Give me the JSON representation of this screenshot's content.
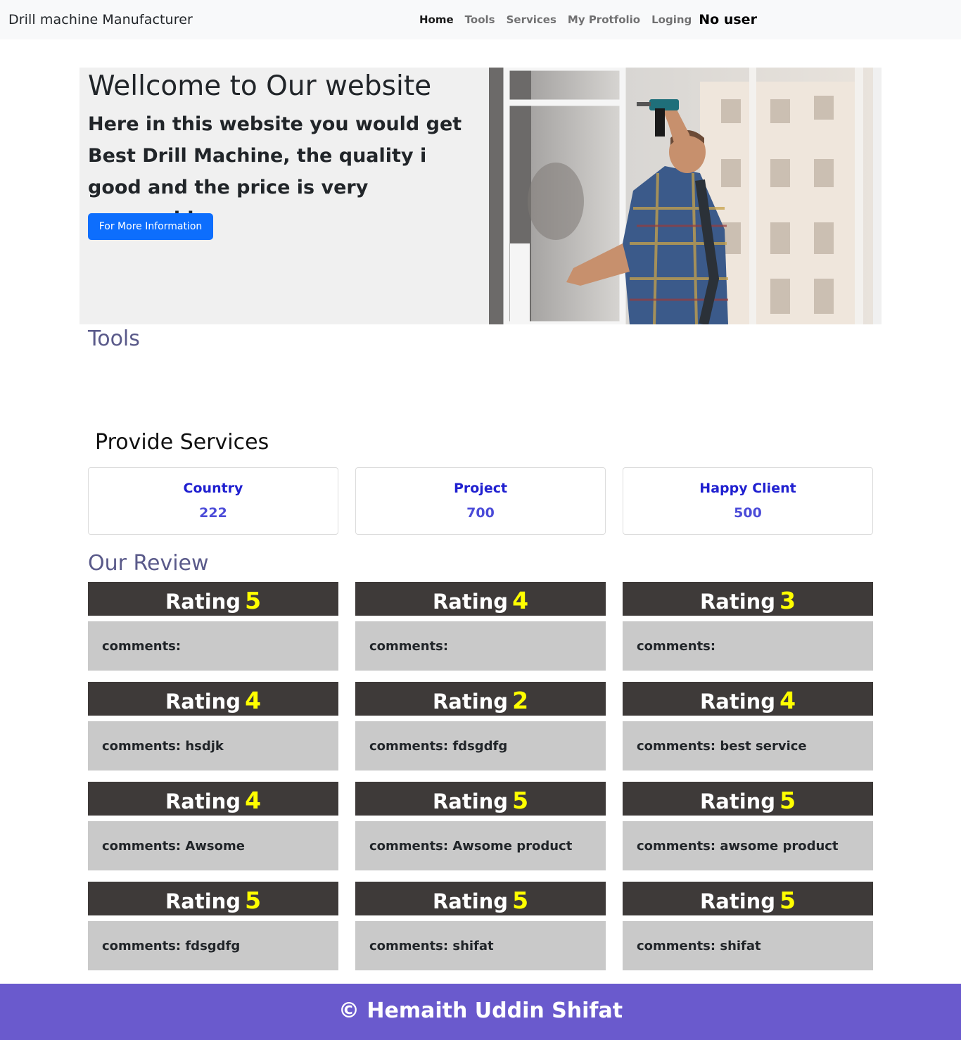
{
  "navbar": {
    "brand": "Drill machine Manufacturer",
    "links": [
      "Home",
      "Tools",
      "Services",
      "My Protfolio",
      "Loging"
    ],
    "user": "No user"
  },
  "hero": {
    "title": "Wellcome to Our website",
    "text": "Here in this website you would get Best Drill Machine, the quality i good and the price is very reasonable.",
    "button": "For More Information"
  },
  "tools": {
    "title": "Tools"
  },
  "services": {
    "title": "Provide Services",
    "cards": [
      {
        "label": "Country",
        "value": "222"
      },
      {
        "label": "Project",
        "value": "700"
      },
      {
        "label": "Happy Client",
        "value": "500"
      }
    ]
  },
  "reviews": {
    "title": "Our Review",
    "rating_label": "Rating",
    "items": [
      {
        "rating": "5",
        "comment": "comments:"
      },
      {
        "rating": "4",
        "comment": "comments:"
      },
      {
        "rating": "3",
        "comment": "comments:"
      },
      {
        "rating": "4",
        "comment": "comments: hsdjk"
      },
      {
        "rating": "2",
        "comment": "comments: fdsgdfg"
      },
      {
        "rating": "4",
        "comment": "comments: best service"
      },
      {
        "rating": "4",
        "comment": "comments: Awsome"
      },
      {
        "rating": "5",
        "comment": "comments: Awsome product"
      },
      {
        "rating": "5",
        "comment": "comments: awsome product"
      },
      {
        "rating": "5",
        "comment": "comments: fdsgdfg"
      },
      {
        "rating": "5",
        "comment": "comments: shifat"
      },
      {
        "rating": "5",
        "comment": "comments: shifat"
      }
    ]
  },
  "footer": {
    "text": "© Hemaith Uddin Shifat"
  },
  "colors": {
    "primary_button": "#0d6efd",
    "rating_header": "#3e3a39",
    "rating_number": "#ffff00",
    "comment_bg": "#c9c9c9",
    "footer_bg": "#6a5acd",
    "service_text": "#2020d0"
  }
}
